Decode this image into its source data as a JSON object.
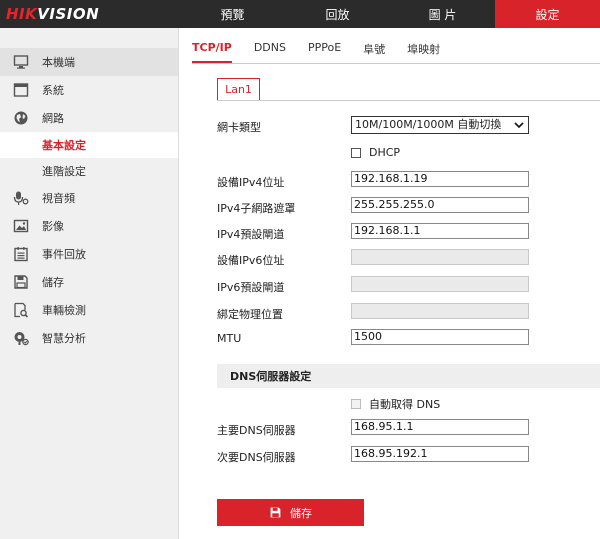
{
  "brand": {
    "logo_prefix": "HIK",
    "logo_suffix": "VISION"
  },
  "top_nav": [
    {
      "label": "預覽"
    },
    {
      "label": "回放"
    },
    {
      "label": "圖 片"
    },
    {
      "label": "設定"
    }
  ],
  "sidebar": {
    "items": [
      {
        "label": "本機端"
      },
      {
        "label": "系統"
      },
      {
        "label": "網路"
      },
      {
        "label": "基本設定"
      },
      {
        "label": "進階設定"
      },
      {
        "label": "視音頻"
      },
      {
        "label": "影像"
      },
      {
        "label": "事件回放"
      },
      {
        "label": "儲存"
      },
      {
        "label": "車輛檢測"
      },
      {
        "label": "智慧分析"
      }
    ]
  },
  "tabs": [
    {
      "label": "TCP/IP"
    },
    {
      "label": "DDNS"
    },
    {
      "label": "PPPoE"
    },
    {
      "label": "阜號"
    },
    {
      "label": "埠映射"
    }
  ],
  "lan_tab": "Lan1",
  "form": {
    "nic_type": {
      "label": "網卡類型",
      "value": "10M/100M/1000M 自動切換"
    },
    "dhcp": {
      "label": "DHCP",
      "checked": false
    },
    "ipv4_address": {
      "label": "設備IPv4位址",
      "value": "192.168.1.19"
    },
    "ipv4_mask": {
      "label": "IPv4子網路遮罩",
      "value": "255.255.255.0"
    },
    "ipv4_gateway": {
      "label": "IPv4預設閘道",
      "value": "192.168.1.1"
    },
    "ipv6_address": {
      "label": "設備IPv6位址",
      "value": ""
    },
    "ipv6_gateway": {
      "label": "IPv6預設閘道",
      "value": ""
    },
    "mac_address": {
      "label": "綁定物理位置",
      "value": ""
    },
    "mtu": {
      "label": "MTU",
      "value": "1500"
    }
  },
  "dns": {
    "section_title": "DNS伺服器設定",
    "auto_dns": {
      "label": "自動取得 DNS",
      "checked": false
    },
    "primary": {
      "label": "主要DNS伺服器",
      "value": "168.95.1.1"
    },
    "secondary": {
      "label": "次要DNS伺服器",
      "value": "168.95.192.1"
    }
  },
  "save_label": "儲存",
  "colors": {
    "accent": "#d9232a",
    "topbar": "#2b2b2b",
    "sidebar": "#f0f0f0"
  }
}
